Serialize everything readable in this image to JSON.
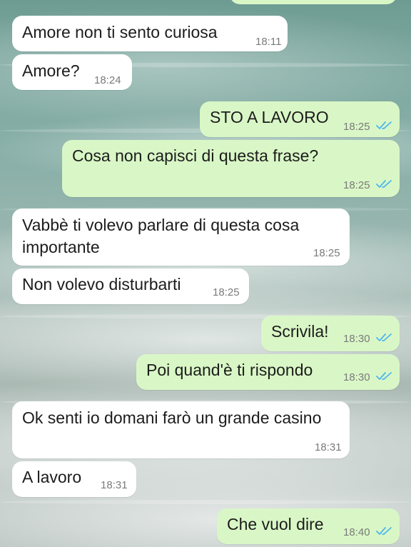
{
  "colors": {
    "incoming_bubble": "#ffffff",
    "outgoing_bubble": "#d9f7c6",
    "read_ticks": "#4fb6ec"
  },
  "messages": [
    {
      "dir": "in",
      "text": "Amore non ti sento curiosa",
      "time": "18:11"
    },
    {
      "dir": "in",
      "text": "Amore?",
      "time": "18:24"
    },
    {
      "dir": "out",
      "text": "STO A LAVORO",
      "time": "18:25",
      "status": "read-ticks-icon"
    },
    {
      "dir": "out",
      "text": "Cosa non capisci di questa frase?",
      "time": "18:25",
      "status": "read-ticks-icon"
    },
    {
      "dir": "in",
      "text": "Vabbè ti volevo parlare di questa cosa importante",
      "time": "18:25"
    },
    {
      "dir": "in",
      "text": "Non volevo disturbarti",
      "time": "18:25"
    },
    {
      "dir": "out",
      "text": "Scrivila!",
      "time": "18:30",
      "status": "read-ticks-icon"
    },
    {
      "dir": "out",
      "text": "Poi quand'è ti rispondo",
      "time": "18:30",
      "status": "read-ticks-icon"
    },
    {
      "dir": "in",
      "text": "Ok senti io domani farò un grande casino",
      "time": "18:31"
    },
    {
      "dir": "in",
      "text": "A lavoro",
      "time": "18:31"
    },
    {
      "dir": "out",
      "text": "Che vuol dire",
      "time": "18:40",
      "status": "read-ticks-icon"
    }
  ]
}
